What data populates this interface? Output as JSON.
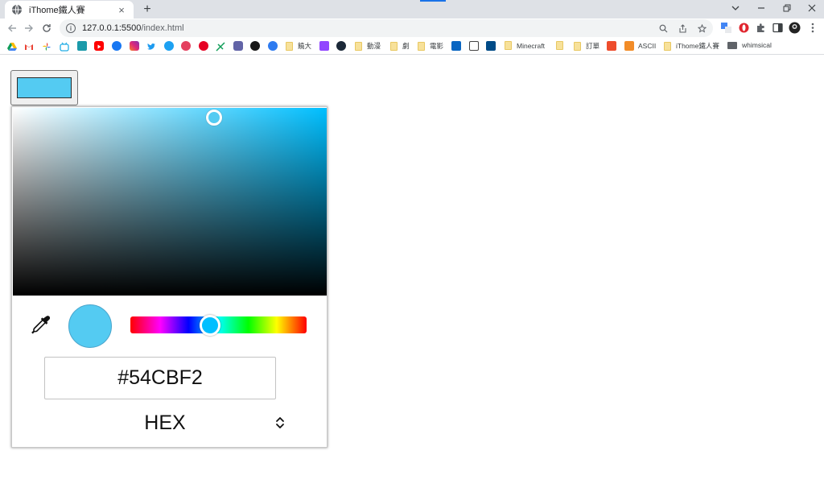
{
  "browser": {
    "tab_title": "iThome鐵人賽",
    "url_host": "127.0.0.1:5500",
    "url_path": "/index.html",
    "new_tab_symbol": "+",
    "close_symbol": "×",
    "accent_color": "#1a73e8"
  },
  "bookmarks": {
    "items": [
      {
        "label": "饒大",
        "type": "folder"
      },
      {
        "label": "動漫",
        "type": "folder"
      },
      {
        "label": "劇",
        "type": "folder"
      },
      {
        "label": "電影",
        "type": "folder"
      },
      {
        "label": "Minecraft",
        "type": "folder"
      },
      {
        "label": "訂單",
        "type": "folder"
      },
      {
        "label": "ASCII",
        "type": "link"
      },
      {
        "label": "iThome鐵人賽",
        "type": "folder"
      },
      {
        "label": "whimsical",
        "type": "folder-dark"
      }
    ]
  },
  "picker": {
    "selected_color": "#54CBF2",
    "hue_color": "#00BFFF",
    "hue_position": 0.454,
    "saturation": 0.64,
    "value": 0.95,
    "hex_value": "#54CBF2",
    "format_label": "HEX",
    "icons": {
      "eyedropper": "eyedropper-icon",
      "format": "chevron-up-down-icon"
    }
  }
}
